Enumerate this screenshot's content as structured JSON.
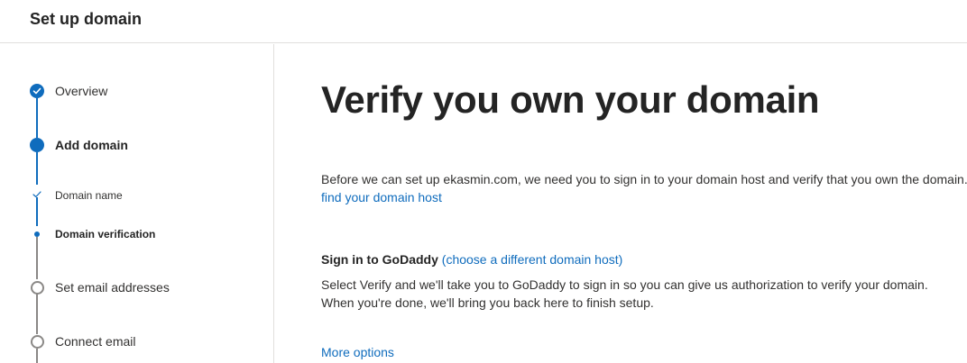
{
  "header": {
    "title": "Set up domain"
  },
  "steps": [
    {
      "label": "Overview",
      "state": "completed"
    },
    {
      "label": "Add domain",
      "state": "current"
    },
    {
      "label": "Set email addresses",
      "state": "pending"
    },
    {
      "label": "Connect email",
      "state": "pending"
    }
  ],
  "substeps": [
    {
      "label": "Domain name",
      "state": "completed"
    },
    {
      "label": "Domain verification",
      "state": "current"
    }
  ],
  "main": {
    "heading": "Verify you own your domain",
    "intro": "Before we can set up ekasmin.com, we need you to sign in to your domain host and verify that you own the domain.",
    "find_host_link": "find your domain host",
    "sign_in_label": "Sign in to GoDaddy",
    "choose_host_link": "(choose a different domain host)",
    "instructions_line1": "Select Verify and we'll take you to GoDaddy to sign in so you can give us authorization to verify your domain.",
    "instructions_line2": "When you're done, we'll bring you back here to finish setup.",
    "more_options_link": "More options"
  },
  "colors": {
    "accent": "#0f6cbd",
    "pending": "#8a8886",
    "divider": "#e1dfdd",
    "text": "#323130"
  },
  "icons": {
    "completed": "checkmark-icon",
    "substep_completed": "small-checkmark-icon"
  }
}
